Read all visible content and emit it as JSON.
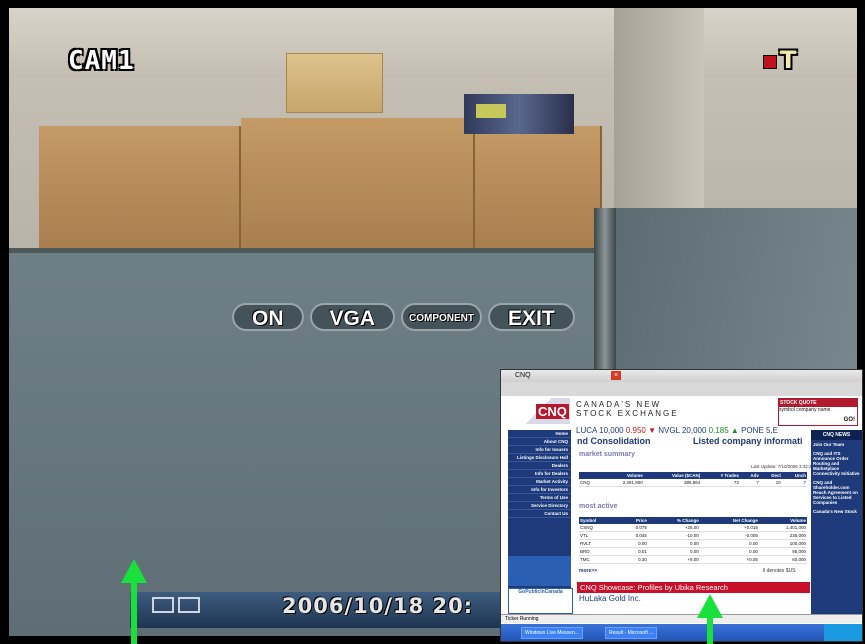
{
  "osd": {
    "camera_label": "CAM1",
    "record_glyph": "T",
    "menu": [
      "ON",
      "VGA",
      "COMPONENT",
      "EXIT"
    ],
    "datetime": "2006/10/18  20:"
  },
  "pip_browser": {
    "window_title": "CNQ",
    "logo": "CNQ",
    "site_name_line1": "CANADA'S NEW",
    "site_name_line2": "STOCK EXCHANGE",
    "stock_quote": {
      "header": "STOCK QUOTE",
      "option1": "symbol",
      "option2": "company name",
      "button": "GO!"
    },
    "ticker": {
      "luca": "LUCA 10,000",
      "luca_change": "0.950 ▼",
      "nvgl": "NVGL 20,000",
      "nvgl_change": "0.185 ▲",
      "pone": "PONE 5,E"
    },
    "headline_left": "nd Consolidation",
    "headline_right": "Listed company informati",
    "left_nav": [
      "Home",
      "About CNQ",
      "Info for Issuers",
      "Listings Disclosure Hall",
      "Dealers",
      "Info for Dealers",
      "Market Activity",
      "Info for Investors",
      "Terms of Use",
      "Service Directory",
      "Contact Us"
    ],
    "nav_ad": "CNQ",
    "nav_ad2": "GoPublicInCanada",
    "market_summary": {
      "title": "market summary",
      "subtitle": "MARKET SUMMARY",
      "last_update": "Last Update: 7/10/2006 3:42:38 PM E.D.T.",
      "headers": [
        "",
        "Volume",
        "Value ($CAN)",
        "# Trades",
        "Adv",
        "Decl",
        "Unch"
      ],
      "rows": [
        [
          "CNQ",
          "2,281,900",
          "386,864",
          "73",
          "7",
          "10",
          "7"
        ]
      ]
    },
    "most_active": {
      "title": "most active",
      "subtitle": "MOST ACTIVE",
      "headers": [
        "Symbol",
        "Price",
        "% Change",
        "Net Change",
        "Volume"
      ],
      "rows": [
        [
          "CSNQ",
          "0.075",
          "+25.00",
          "+0.015",
          "1,401,000"
        ],
        [
          "VTL",
          "0.045",
          "-10.00",
          "-0.005",
          "235,000"
        ],
        [
          "RVLT",
          "0.00",
          "0.00",
          "0.00",
          "100,000"
        ],
        [
          "BRD",
          "0.01",
          "0.00",
          "0.00",
          "95,000"
        ],
        [
          "TMC",
          "0.30",
          "+9.00",
          "+0.05",
          "60,000"
        ]
      ],
      "more": "more>>",
      "note": "ll denotes $US"
    },
    "right_nav": {
      "title": "CNQ NEWS",
      "items": [
        "Join Our Team",
        "CNQ and ITS Announce Order Routing and Marketplace Connectivity Initiative",
        "CNQ and Shareholder.com Reach Agreement on Services to Listed Companies",
        "Canada's New Stock"
      ]
    },
    "showcase": "CNQ Showcase: Profiles by Ubika Research",
    "showcase_sub": "HuLaka Gold Inc.",
    "status_text": "Ticker Running",
    "taskbar_items": [
      "Windows Live Messen...",
      "Result - Microsoft ..."
    ]
  },
  "annotations": {
    "arrow_color": "#19e03b",
    "arrow_count": 2
  }
}
